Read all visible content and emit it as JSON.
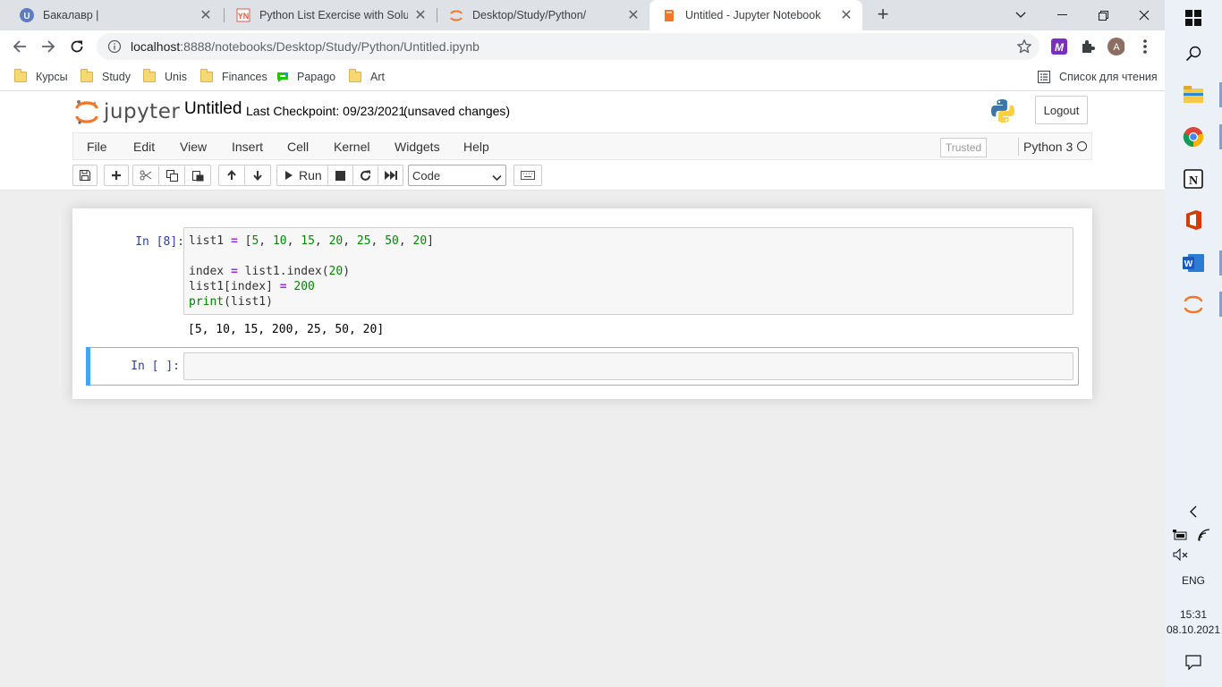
{
  "browser": {
    "tabs": [
      {
        "title": "Бакалавр |",
        "icon": "u-circle-icon"
      },
      {
        "title": "Python List Exercise with Solution",
        "icon": "pynative-icon"
      },
      {
        "title": "Desktop/Study/Python/",
        "icon": "jupyter-icon"
      },
      {
        "title": "Untitled - Jupyter Notebook",
        "icon": "notebook-icon",
        "active": true
      }
    ],
    "url_host": "localhost",
    "url_path": ":8888/notebooks/Desktop/Study/Python/Untitled.ipynb",
    "profile_initial": "A",
    "bookmarks": [
      {
        "label": "Курсы",
        "icon": "folder-icon"
      },
      {
        "label": "Study",
        "icon": "folder-icon"
      },
      {
        "label": "Unis",
        "icon": "folder-icon"
      },
      {
        "label": "Finances",
        "icon": "folder-icon"
      },
      {
        "label": "Papago",
        "icon": "papago-icon"
      },
      {
        "label": "Art",
        "icon": "folder-icon"
      }
    ],
    "reading_list": "Список для чтения"
  },
  "jupyter": {
    "logo_text": "jupyter",
    "notebook_name": "Untitled",
    "checkpoint": "Last Checkpoint: 09/23/2021",
    "autosave": "(unsaved changes)",
    "logout": "Logout",
    "menu": [
      "File",
      "Edit",
      "View",
      "Insert",
      "Cell",
      "Kernel",
      "Widgets",
      "Help"
    ],
    "trusted": "Trusted",
    "kernel": "Python 3",
    "run_label": "Run",
    "cell_type": "Code",
    "cells": [
      {
        "prompt": "In [8]:",
        "output": "[5, 10, 15, 200, 25, 50, 20]"
      },
      {
        "prompt": "In [ ]:",
        "output": ""
      }
    ]
  },
  "taskbar": {
    "language": "ENG",
    "time": "15:31",
    "date": "08.10.2021"
  },
  "colors": {
    "accent_blue": "#42a5f5",
    "prompt_blue": "#303f9f",
    "number_green": "#008000",
    "operator_purple": "#aa22ff"
  }
}
